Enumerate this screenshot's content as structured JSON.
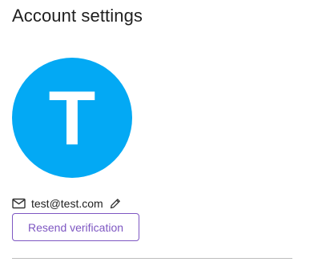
{
  "header": {
    "title": "Account settings"
  },
  "profile": {
    "avatar_initial": "T",
    "avatar_color": "#03a9f4",
    "email": "test@test.com",
    "email_icon": "mail-icon",
    "edit_icon": "pencil-icon",
    "resend_label": "Resend verification",
    "accent_color": "#7e57c2"
  }
}
